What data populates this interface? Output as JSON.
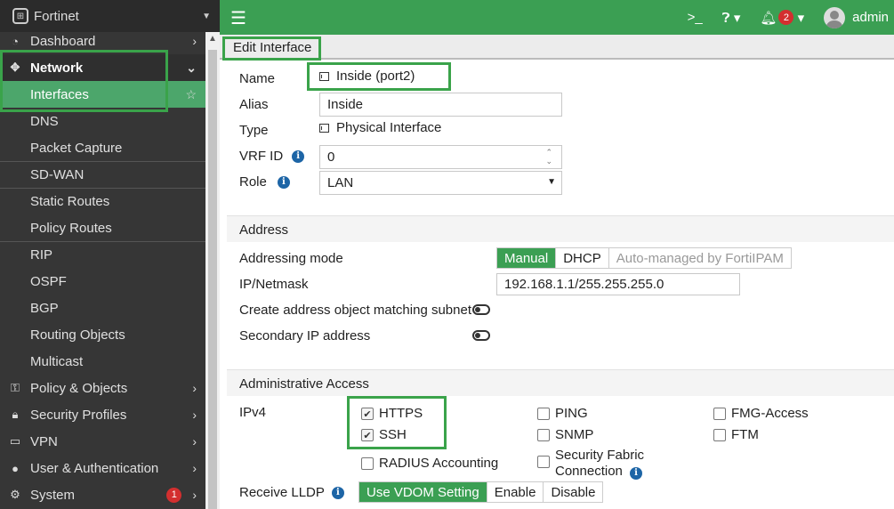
{
  "app": {
    "brand": "Fortinet"
  },
  "sidebar": {
    "items": [
      {
        "label": "Dashboard",
        "icon": "dashboard-icon"
      },
      {
        "label": "Network",
        "icon": "network-move-icon"
      },
      {
        "label": "Interfaces"
      },
      {
        "label": "DNS"
      },
      {
        "label": "Packet Capture"
      },
      {
        "label": "SD-WAN"
      },
      {
        "label": "Static Routes"
      },
      {
        "label": "Policy Routes"
      },
      {
        "label": "RIP"
      },
      {
        "label": "OSPF"
      },
      {
        "label": "BGP"
      },
      {
        "label": "Routing Objects"
      },
      {
        "label": "Multicast"
      },
      {
        "label": "Policy & Objects",
        "icon": "policy-icon"
      },
      {
        "label": "Security Profiles",
        "icon": "lock-icon"
      },
      {
        "label": "VPN",
        "icon": "laptop-icon"
      },
      {
        "label": "User & Authentication",
        "icon": "user-icon"
      },
      {
        "label": "System",
        "icon": "gear-icon",
        "badge": "1"
      }
    ]
  },
  "topbar": {
    "notifications": "2",
    "user": "admin"
  },
  "page": {
    "title": "Edit Interface"
  },
  "form": {
    "name_label": "Name",
    "name_value": "Inside (port2)",
    "alias_label": "Alias",
    "alias_value": "Inside",
    "type_label": "Type",
    "type_value": "Physical Interface",
    "vrf_label": "VRF ID",
    "vrf_value": "0",
    "role_label": "Role",
    "role_value": "LAN"
  },
  "address": {
    "header": "Address",
    "mode_label": "Addressing mode",
    "modes": [
      "Manual",
      "DHCP",
      "Auto-managed by FortiIPAM"
    ],
    "ipmask_label": "IP/Netmask",
    "ipmask_value": "192.168.1.1/255.255.255.0",
    "create_obj_label": "Create address object matching subnet",
    "secondary_label": "Secondary IP address"
  },
  "admin_access": {
    "header": "Administrative Access",
    "ipv4_label": "IPv4",
    "https": "HTTPS",
    "ssh": "SSH",
    "radius": "RADIUS Accounting",
    "ping": "PING",
    "snmp": "SNMP",
    "fabric1": "Security Fabric",
    "fabric2": "Connection",
    "fmg": "FMG-Access",
    "ftm": "FTM",
    "lldp_label": "Receive LLDP",
    "lldp_opts": [
      "Use VDOM Setting",
      "Enable",
      "Disable"
    ]
  },
  "colors": {
    "accent": "#3b9f53",
    "sidebar": "#363636",
    "highlight": "#3aa34a"
  }
}
